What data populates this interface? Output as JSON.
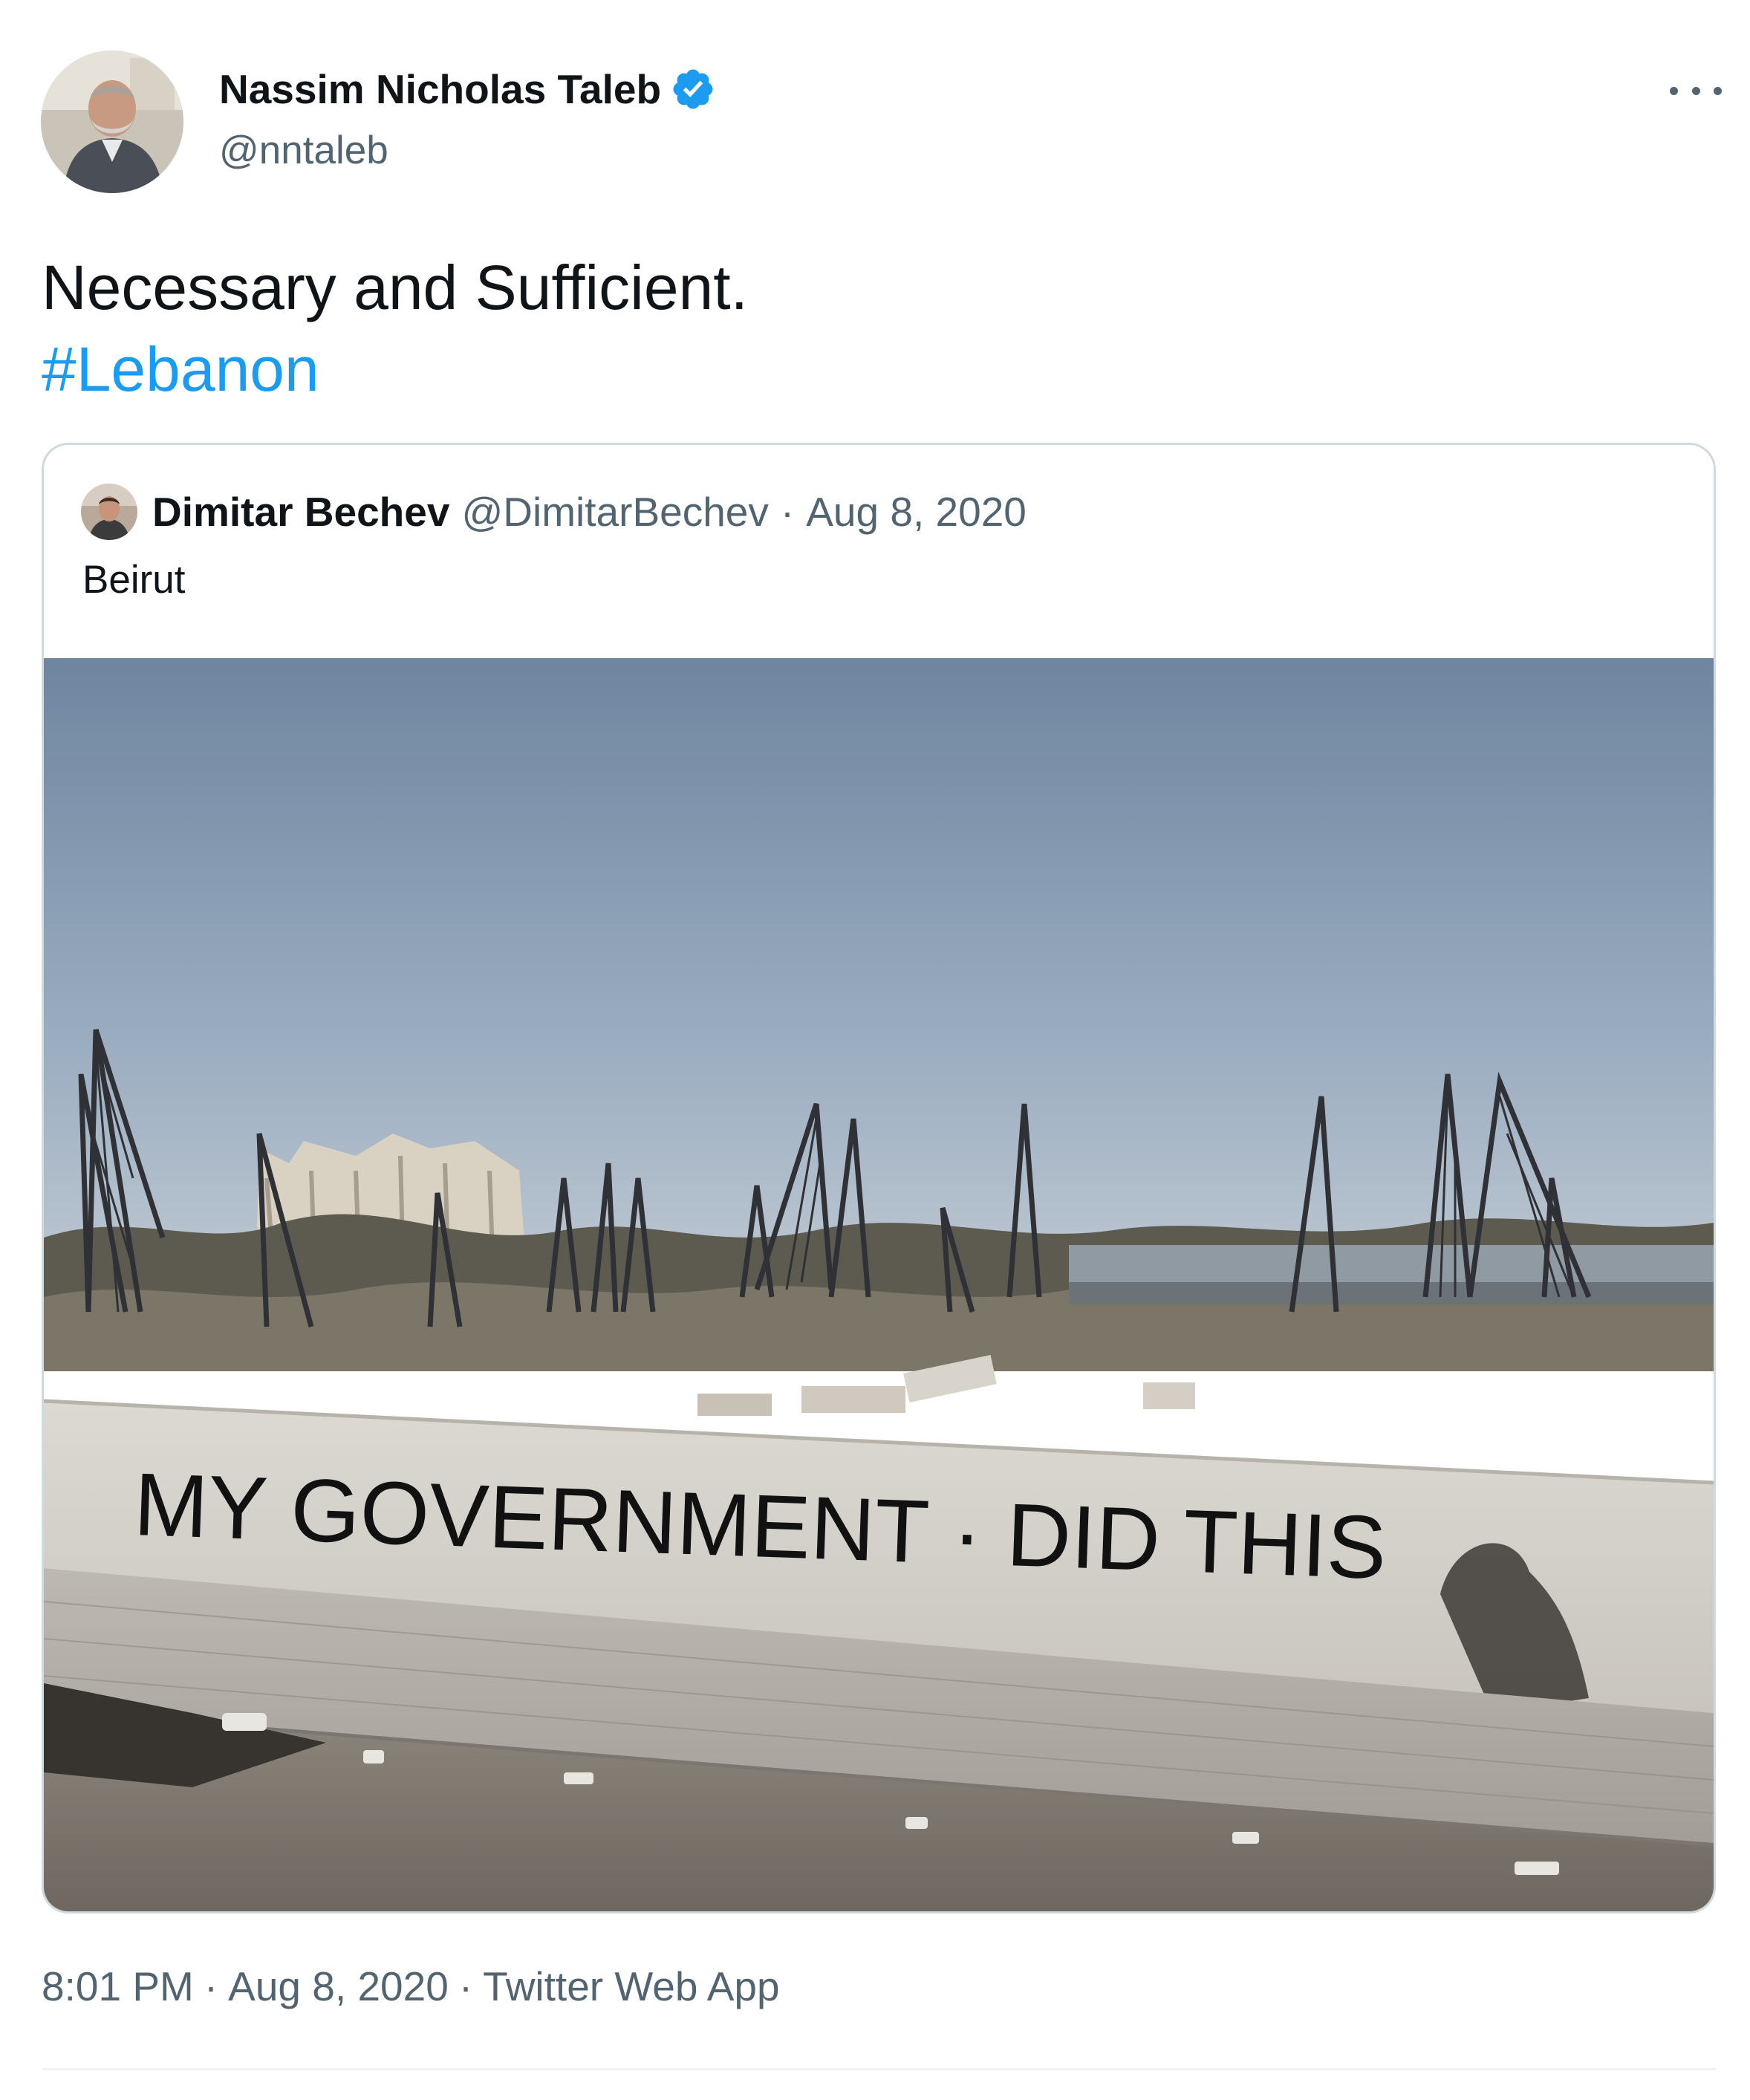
{
  "author": {
    "name": "Nassim Nicholas Taleb",
    "handle": "@nntaleb",
    "verified": true
  },
  "tweet": {
    "text": "Necessary and Sufficient.",
    "hashtag": "#Lebanon"
  },
  "quoted_tweet": {
    "name": "Dimitar Bechev",
    "handle": "@DimitarBechev",
    "separator": "·",
    "date": "Aug 8, 2020",
    "text": "Beirut",
    "photo_graffiti": "MY GOVERNMENT DID THIS"
  },
  "meta": {
    "time": "8:01 PM",
    "separator": "·",
    "date": "Aug 8, 2020",
    "source": "Twitter Web App"
  },
  "colors": {
    "link": "#1d9bf0",
    "secondary_text": "#536471",
    "border": "#cfd9de",
    "verified_badge": "#1d9bf0"
  },
  "icons": {
    "verified": "verified-badge-icon",
    "more": "more-options-icon"
  }
}
